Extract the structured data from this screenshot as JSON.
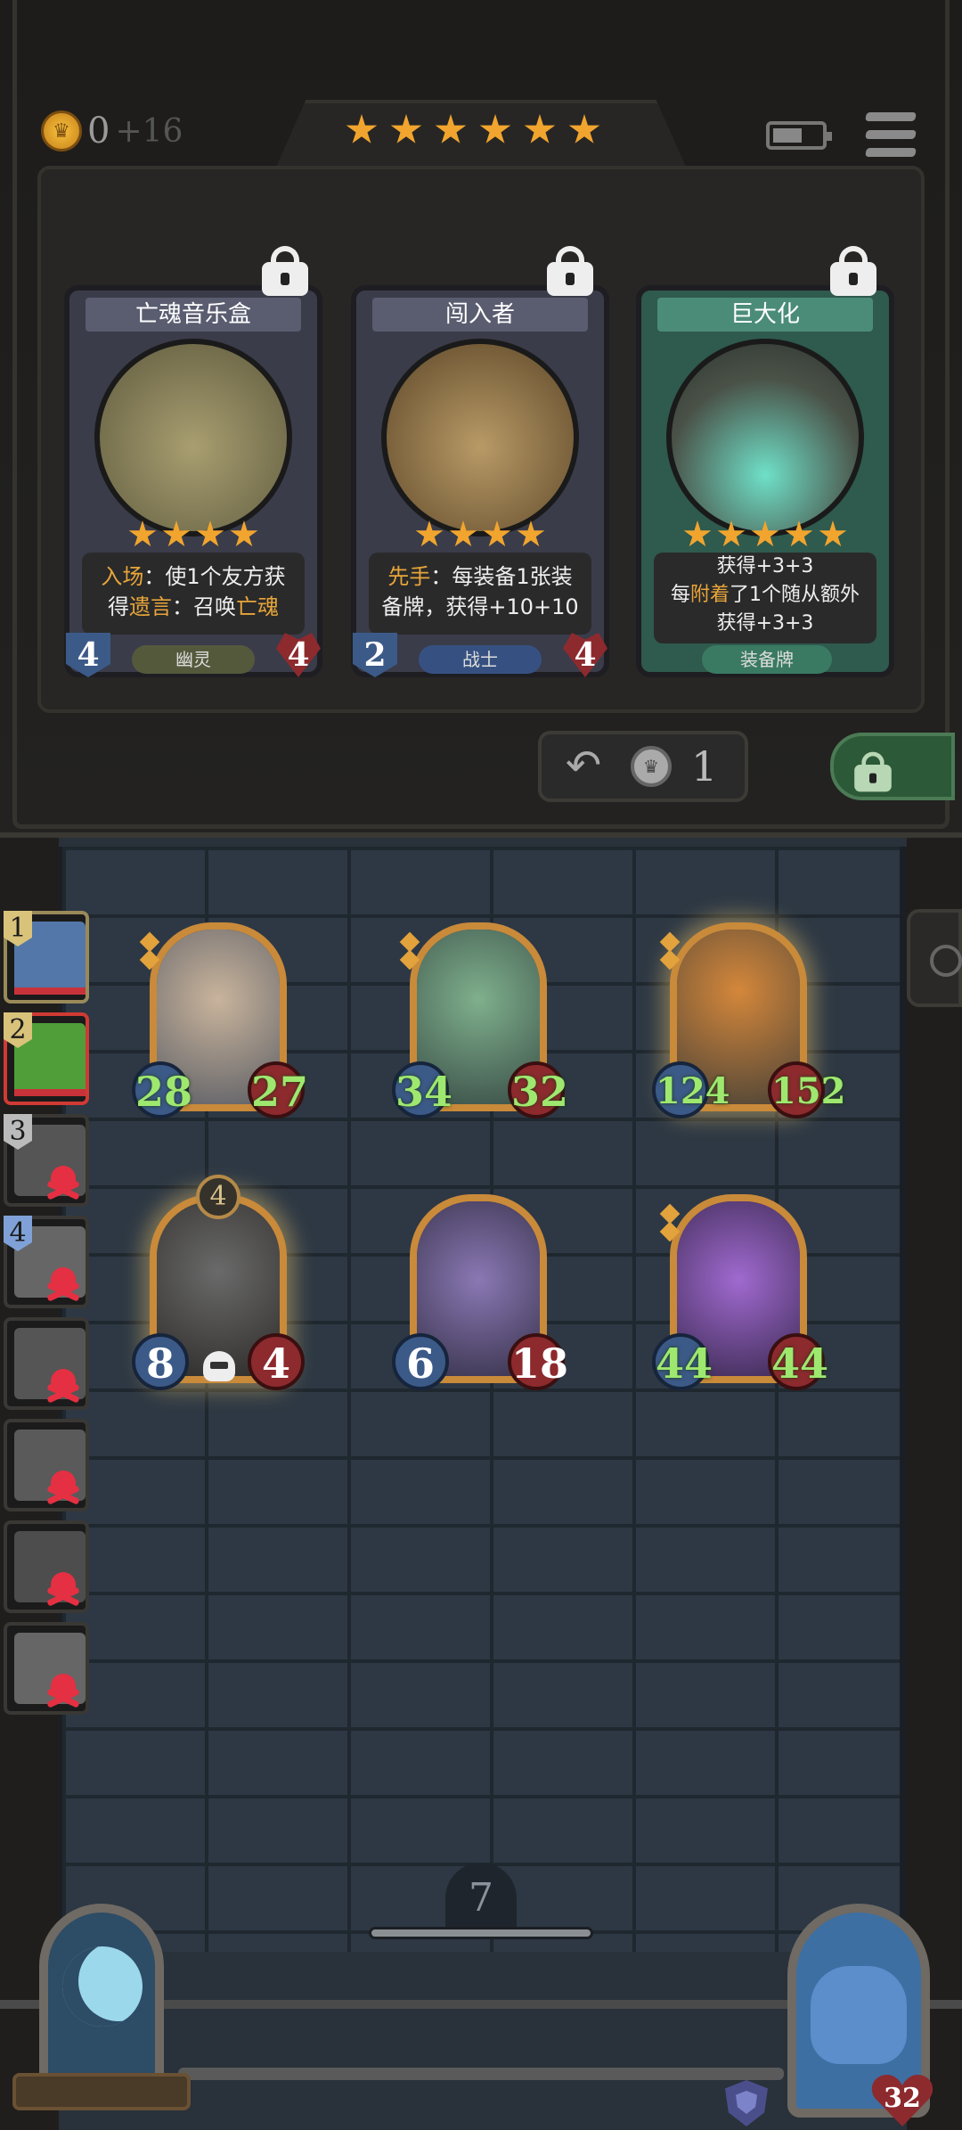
{
  "header": {
    "gold": "0",
    "gold_income": "+16",
    "tavern_stars": 6
  },
  "shop": {
    "cards": [
      {
        "title": "亡魂音乐盒",
        "text_line1_prefix": "入场",
        "text_line1_rest": "：使1个友方获",
        "text_line2_prefix": "得",
        "text_line2_highlight": "遗言",
        "text_line2_mid": "：召唤",
        "text_line2_end": "亡魂",
        "tag": "幽灵",
        "attack": "4",
        "health": "4",
        "stars": 4,
        "art_color": "#7f7a52"
      },
      {
        "title": "闯入者",
        "text_line1_prefix": "先手",
        "text_line1_rest": "：每装备1张装",
        "text_line2": "备牌，获得+10+10",
        "tag": "战士",
        "attack": "2",
        "health": "4",
        "stars": 4,
        "art_color": "#8a6a3e"
      },
      {
        "title": "巨大化",
        "text_line1": "获得+3+3",
        "text_line2_pre": "每",
        "text_line2_highlight": "附着",
        "text_line2_rest": "了1个随从额外",
        "text_line3": "获得+3+3",
        "tag": "装备牌",
        "stars": 5,
        "art_color": "#5c6e5a"
      }
    ],
    "refresh_cost": "1"
  },
  "opponents": [
    {
      "rank": "1",
      "state": "active",
      "eliminated": false,
      "color": "#5377a8"
    },
    {
      "rank": "2",
      "state": "current",
      "eliminated": false,
      "color": "#4f9e3a"
    },
    {
      "rank": "3",
      "state": "normal",
      "eliminated": true,
      "color": "#555"
    },
    {
      "rank": "4",
      "state": "normal",
      "eliminated": true,
      "color": "#666"
    },
    {
      "rank": "",
      "state": "normal",
      "eliminated": true,
      "color": "#555"
    },
    {
      "rank": "",
      "state": "normal",
      "eliminated": true,
      "color": "#5a5a5a"
    },
    {
      "rank": "",
      "state": "normal",
      "eliminated": true,
      "color": "#4d4d4d"
    },
    {
      "rank": "",
      "state": "normal",
      "eliminated": true,
      "color": "#666"
    }
  ],
  "board": {
    "minions": [
      {
        "name": "bearded-warrior",
        "attack": "28",
        "health": "27",
        "buffed": true,
        "art": "#8f8a86"
      },
      {
        "name": "parrot-pirate",
        "attack": "34",
        "health": "32",
        "buffed": true,
        "art": "#5d8a6b"
      },
      {
        "name": "pumpkin-scarecrow",
        "attack": "124",
        "health": "152",
        "buffed": true,
        "art": "#b4702e"
      },
      {
        "name": "shield-knight",
        "attack": "8",
        "health": "4",
        "buffed": false,
        "level": "4",
        "art": "#4a4a4a"
      },
      {
        "name": "octopus-pirate",
        "attack": "6",
        "health": "18",
        "buffed": false,
        "art": "#6e5f92"
      },
      {
        "name": "octopus-pirate-golden",
        "attack": "44",
        "health": "44",
        "buffed": true,
        "art": "#7a4fa0"
      }
    ],
    "turn": "7"
  },
  "hero": {
    "health": "32"
  },
  "colors": {
    "accent_gold": "#f1a52e",
    "buff_green": "#9ee86f"
  }
}
